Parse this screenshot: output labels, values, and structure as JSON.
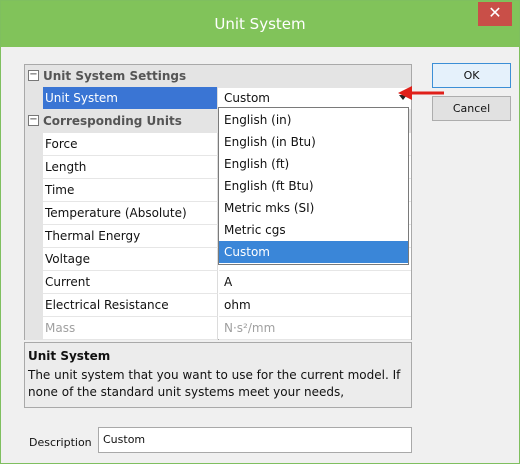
{
  "window": {
    "title": "Unit System",
    "close_glyph": "✕"
  },
  "grid": {
    "settings_category": "Unit System Settings",
    "unit_system_label": "Unit System",
    "unit_system_value": "Custom",
    "corresponding_category": "Corresponding Units",
    "toggle_glyph": "−",
    "rows": [
      {
        "name": "Force",
        "value": ""
      },
      {
        "name": "Length",
        "value": ""
      },
      {
        "name": "Time",
        "value": ""
      },
      {
        "name": "Temperature (Absolute)",
        "value": ""
      },
      {
        "name": "Thermal Energy",
        "value": ""
      },
      {
        "name": "Voltage",
        "value": ""
      },
      {
        "name": "Current",
        "value": "A"
      },
      {
        "name": "Electrical Resistance",
        "value": "ohm"
      },
      {
        "name": "Mass",
        "value": "N·s²/mm"
      }
    ]
  },
  "dropdown": {
    "options": [
      "English (in)",
      "English (in Btu)",
      "English (ft)",
      "English (ft Btu)",
      "Metric mks (SI)",
      "Metric cgs",
      "Custom"
    ],
    "selected": "Custom"
  },
  "help": {
    "title": "Unit System",
    "text": "The unit system that you want to use for the current model. If none of the standard unit systems meet your needs,"
  },
  "description": {
    "label": "Description",
    "value": "Custom"
  },
  "buttons": {
    "ok": "OK",
    "cancel": "Cancel"
  },
  "colors": {
    "titlebar": "#81c35a",
    "selection": "#3a75d4",
    "close": "#c94f48",
    "arrow": "#e0201a"
  }
}
